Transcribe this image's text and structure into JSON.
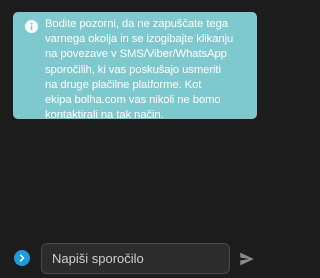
{
  "notice": {
    "icon": "info-icon",
    "lines": [
      "Bodite pozorni, da ne zapuščate tega",
      "varnega okolja in se izogibajte klikanju",
      "na povezave v SMS/Viber/WhatsApp",
      "sporočilih, ki vas poskušajo usmeriti",
      "na druge plačilne platforme. Kot",
      "ekipa bolha.com vas nikoli ne bomo",
      "kontaktirali na tak način."
    ],
    "background": "#7fc9ce",
    "text_color": "#ffffff"
  },
  "composer": {
    "expand_icon": "chevron-right-icon",
    "expand_color": "#1f9bdc",
    "placeholder": "Napiši sporočilo",
    "value": "",
    "send_icon": "send-icon"
  },
  "colors": {
    "background": "#1c1c1c"
  }
}
